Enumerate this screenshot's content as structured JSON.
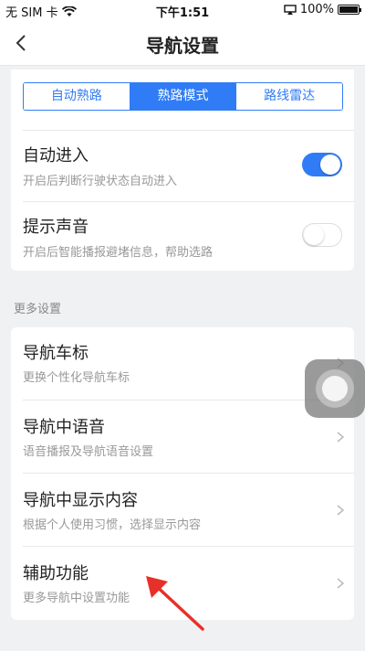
{
  "status_bar": {
    "carrier": "无 SIM 卡",
    "time": "下午1:51",
    "battery": "100%"
  },
  "header": {
    "title": "导航设置"
  },
  "segments": [
    {
      "label": "自动熟路",
      "active": false
    },
    {
      "label": "熟路模式",
      "active": true
    },
    {
      "label": "路线雷达",
      "active": false
    }
  ],
  "toggles": [
    {
      "title": "自动进入",
      "subtitle": "开启后判断行驶状态自动进入",
      "on": true
    },
    {
      "title": "提示声音",
      "subtitle": "开启后智能播报避堵信息，帮助选路",
      "on": false
    }
  ],
  "more_section": {
    "label": "更多设置",
    "items": [
      {
        "title": "导航车标",
        "subtitle": "更换个性化导航车标"
      },
      {
        "title": "导航中语音",
        "subtitle": "语音播报及导航语音设置"
      },
      {
        "title": "导航中显示内容",
        "subtitle": "根据个人使用习惯，选择显示内容"
      },
      {
        "title": "辅助功能",
        "subtitle": "更多导航中设置功能"
      }
    ]
  },
  "colors": {
    "accent": "#2f7cf6",
    "annotation": "#e8302a"
  }
}
